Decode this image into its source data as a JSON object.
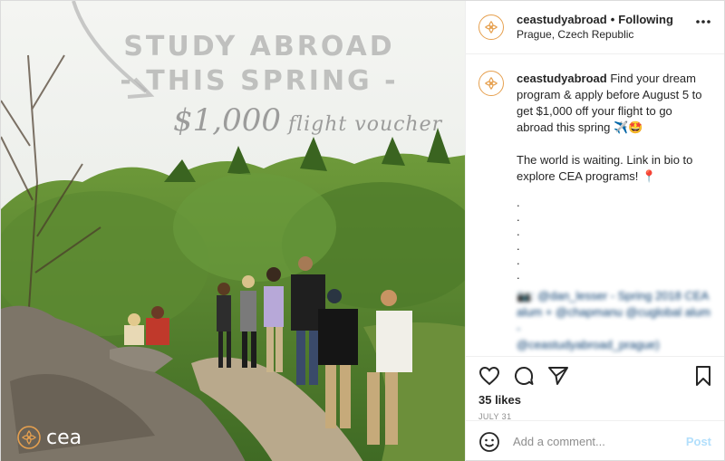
{
  "post": {
    "image": {
      "headline_line1": "STUDY ABROAD",
      "headline_line2": "- THIS SPRING -",
      "voucher_amount": "$1,000",
      "voucher_text": "flight voucher",
      "watermark": "cea"
    },
    "header": {
      "username": "ceastudyabroad",
      "separator": "•",
      "follow_status": "Following",
      "location": "Prague, Czech Republic",
      "more_icon": "more-horizontal-icon"
    },
    "caption": {
      "username": "ceastudyabroad",
      "paragraph1": "Find your dream program & apply before August 5 to get $1,000 off your flight to go abroad this spring ✈️🤩",
      "paragraph2": "The world is waiting. Link in bio to explore CEA programs! 📍",
      "dots": [
        ".",
        ".",
        ".",
        ".",
        ".",
        "."
      ],
      "credit_line1": "📷: @dan_lesser - Spring 2018 CEA",
      "credit_line2": "alum + @chapmanu @cuglobal alum -",
      "credit_line3": "@ceastudyabroad_prague)",
      "trailing_dots": [
        ".",
        "."
      ]
    },
    "actions": {
      "likes": "35 likes",
      "date": "JULY 31"
    },
    "comment_bar": {
      "placeholder": "Add a comment...",
      "post_label": "Post"
    }
  },
  "colors": {
    "brand": "#e6a04f",
    "link": "#00376b",
    "post_button": "#b2dffc",
    "muted": "#8e8e8e"
  }
}
